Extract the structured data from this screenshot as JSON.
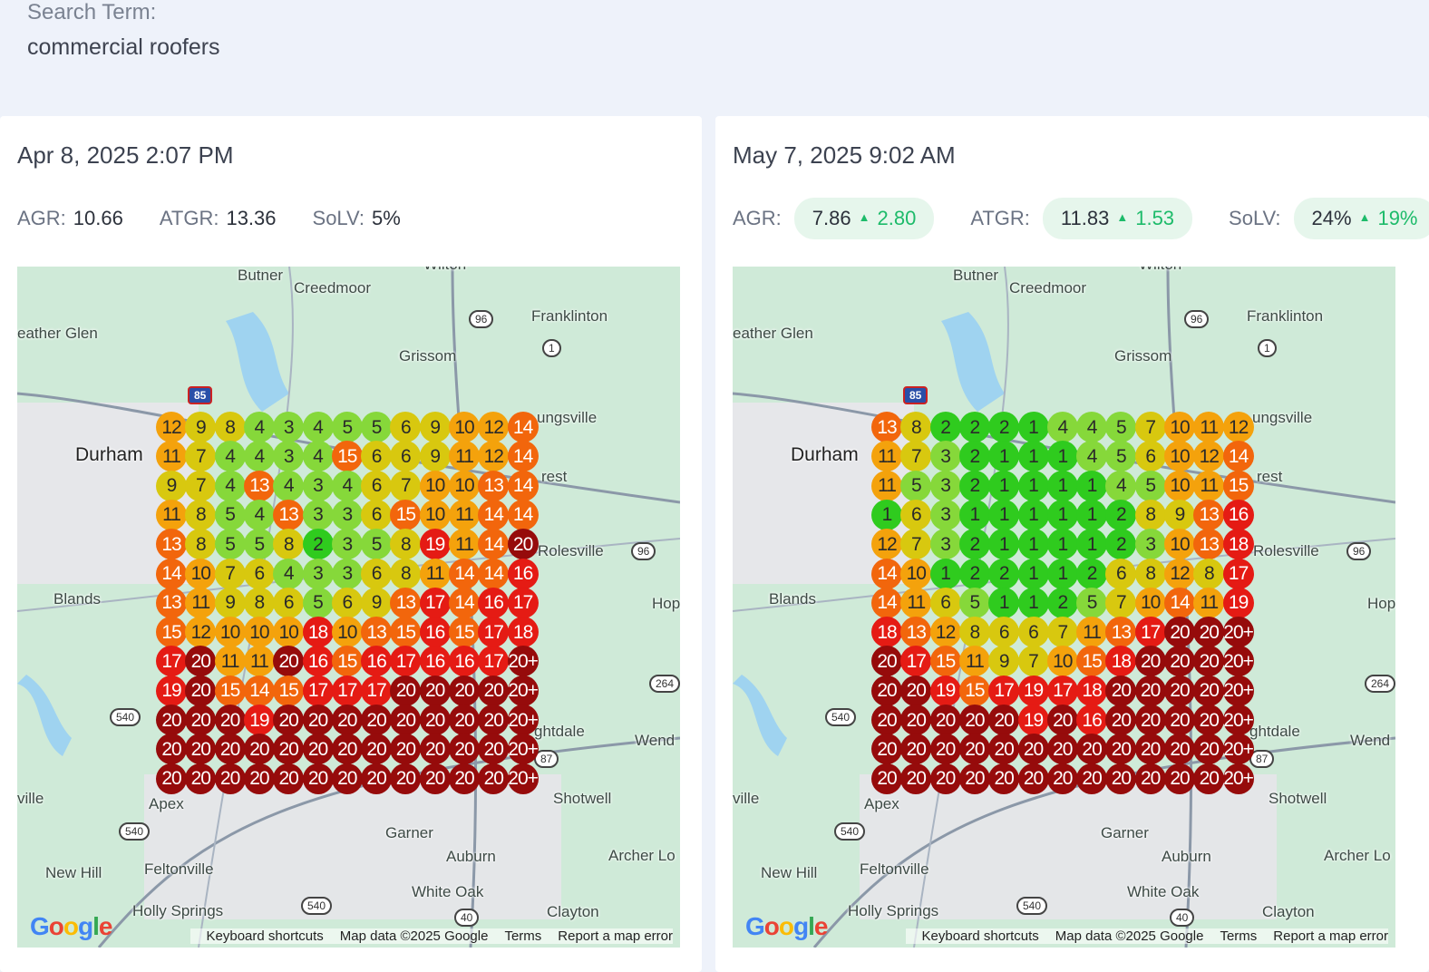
{
  "search": {
    "label": "Search Term:",
    "value": "commercial roofers"
  },
  "panels": [
    {
      "date": "Apr 8, 2025 2:07 PM",
      "metrics": [
        {
          "label": "AGR:",
          "value": "10.66",
          "delta": ""
        },
        {
          "label": "ATGR:",
          "value": "13.36",
          "delta": ""
        },
        {
          "label": "SoLV:",
          "value": "5%",
          "delta": ""
        }
      ],
      "grid": [
        [
          "12",
          "9",
          "8",
          "4",
          "3",
          "4",
          "5",
          "5",
          "6",
          "9",
          "10",
          "12",
          "14"
        ],
        [
          "11",
          "7",
          "4",
          "4",
          "3",
          "4",
          "15",
          "6",
          "6",
          "9",
          "11",
          "12",
          "14"
        ],
        [
          "9",
          "7",
          "4",
          "13",
          "4",
          "3",
          "4",
          "6",
          "7",
          "10",
          "10",
          "13",
          "14"
        ],
        [
          "11",
          "8",
          "5",
          "4",
          "13",
          "3",
          "3",
          "6",
          "15",
          "10",
          "11",
          "14",
          "14"
        ],
        [
          "13",
          "8",
          "5",
          "5",
          "8",
          "2",
          "3",
          "5",
          "8",
          "19",
          "11",
          "14",
          "20"
        ],
        [
          "14",
          "10",
          "7",
          "6",
          "4",
          "3",
          "3",
          "6",
          "8",
          "11",
          "14",
          "14",
          "16"
        ],
        [
          "13",
          "11",
          "9",
          "8",
          "6",
          "5",
          "6",
          "9",
          "13",
          "17",
          "14",
          "16",
          "17"
        ],
        [
          "15",
          "12",
          "10",
          "10",
          "10",
          "18",
          "10",
          "13",
          "15",
          "16",
          "15",
          "17",
          "18"
        ],
        [
          "17",
          "20",
          "11",
          "11",
          "20",
          "16",
          "15",
          "16",
          "17",
          "16",
          "16",
          "17",
          "20+"
        ],
        [
          "19",
          "20",
          "15",
          "14",
          "15",
          "17",
          "17",
          "17",
          "20",
          "20",
          "20",
          "20",
          "20+"
        ],
        [
          "20",
          "20",
          "20",
          "19",
          "20",
          "20",
          "20",
          "20",
          "20",
          "20",
          "20",
          "20",
          "20+"
        ],
        [
          "20",
          "20",
          "20",
          "20",
          "20",
          "20",
          "20",
          "20",
          "20",
          "20",
          "20",
          "20",
          "20+"
        ],
        [
          "20",
          "20",
          "20",
          "20",
          "20",
          "20",
          "20",
          "20",
          "20",
          "20",
          "20",
          "20",
          "20+"
        ]
      ]
    },
    {
      "date": "May 7, 2025 9:02 AM",
      "metrics": [
        {
          "label": "AGR:",
          "value": "7.86",
          "delta": "2.80"
        },
        {
          "label": "ATGR:",
          "value": "11.83",
          "delta": "1.53"
        },
        {
          "label": "SoLV:",
          "value": "24%",
          "delta": "19%"
        }
      ],
      "grid": [
        [
          "13",
          "8",
          "2",
          "2",
          "2",
          "1",
          "4",
          "4",
          "5",
          "7",
          "10",
          "11",
          "12"
        ],
        [
          "11",
          "7",
          "3",
          "2",
          "1",
          "1",
          "1",
          "4",
          "5",
          "6",
          "10",
          "12",
          "14"
        ],
        [
          "11",
          "5",
          "3",
          "2",
          "1",
          "1",
          "1",
          "1",
          "4",
          "5",
          "10",
          "11",
          "15"
        ],
        [
          "1",
          "6",
          "3",
          "1",
          "1",
          "1",
          "1",
          "1",
          "2",
          "8",
          "9",
          "13",
          "16"
        ],
        [
          "12",
          "7",
          "3",
          "2",
          "1",
          "1",
          "1",
          "1",
          "2",
          "3",
          "10",
          "13",
          "18"
        ],
        [
          "14",
          "10",
          "1",
          "2",
          "2",
          "1",
          "1",
          "2",
          "6",
          "8",
          "12",
          "8",
          "17"
        ],
        [
          "14",
          "11",
          "6",
          "5",
          "1",
          "1",
          "2",
          "5",
          "7",
          "10",
          "14",
          "11",
          "19"
        ],
        [
          "18",
          "13",
          "12",
          "8",
          "6",
          "6",
          "7",
          "11",
          "13",
          "17",
          "20",
          "20",
          "20+"
        ],
        [
          "20",
          "17",
          "15",
          "11",
          "9",
          "7",
          "10",
          "15",
          "18",
          "20",
          "20",
          "20",
          "20+"
        ],
        [
          "20",
          "20",
          "19",
          "15",
          "17",
          "19",
          "17",
          "18",
          "20",
          "20",
          "20",
          "20",
          "20+"
        ],
        [
          "20",
          "20",
          "20",
          "20",
          "20",
          "19",
          "20",
          "16",
          "20",
          "20",
          "20",
          "20",
          "20+"
        ],
        [
          "20",
          "20",
          "20",
          "20",
          "20",
          "20",
          "20",
          "20",
          "20",
          "20",
          "20",
          "20",
          "20+"
        ],
        [
          "20",
          "20",
          "20",
          "20",
          "20",
          "20",
          "20",
          "20",
          "20",
          "20",
          "20",
          "20",
          "20+"
        ]
      ]
    }
  ],
  "map": {
    "places": [
      {
        "name": "Butner"
      },
      {
        "name": "Creedmoor"
      },
      {
        "name": "Wilton"
      },
      {
        "name": "eather Glen"
      },
      {
        "name": "Franklinton"
      },
      {
        "name": "Grissom"
      },
      {
        "name": "Durham"
      },
      {
        "name": "ungsville"
      },
      {
        "name": "rest"
      },
      {
        "name": "Rolesville"
      },
      {
        "name": "Blands"
      },
      {
        "name": "Hop"
      },
      {
        "name": "Wend"
      },
      {
        "name": "ghtdale"
      },
      {
        "name": "Shotwell"
      },
      {
        "name": "ville"
      },
      {
        "name": "Apex"
      },
      {
        "name": "Garner"
      },
      {
        "name": "Auburn"
      },
      {
        "name": "Archer Lo"
      },
      {
        "name": "New Hill"
      },
      {
        "name": "Feltonville"
      },
      {
        "name": "White Oak"
      },
      {
        "name": "Holly Springs"
      },
      {
        "name": "Clayton"
      }
    ],
    "shields": [
      {
        "name": "85"
      },
      {
        "name": "96"
      },
      {
        "name": "1"
      },
      {
        "name": "96"
      },
      {
        "name": "264"
      },
      {
        "name": "540"
      },
      {
        "name": "540"
      },
      {
        "name": "540"
      },
      {
        "name": "40"
      },
      {
        "name": "87"
      }
    ],
    "google_logo": "Google",
    "footer": {
      "shortcuts": "Keyboard shortcuts",
      "data": "Map data ©2025 Google",
      "terms": "Terms",
      "report": "Report a map error"
    }
  },
  "colors": {
    "delta_up": "#1dbb6a",
    "pill_bg": "#e6f6ec",
    "rank_1": "#2fcb1e",
    "rank_4": "#86d83a",
    "rank_8": "#d8c80f",
    "rank_11": "#f4a20c",
    "rank_14": "#f2660c",
    "rank_17": "#e51b14",
    "rank_20": "#960b0b"
  },
  "icons": {
    "delta": "triangle-up-icon"
  }
}
